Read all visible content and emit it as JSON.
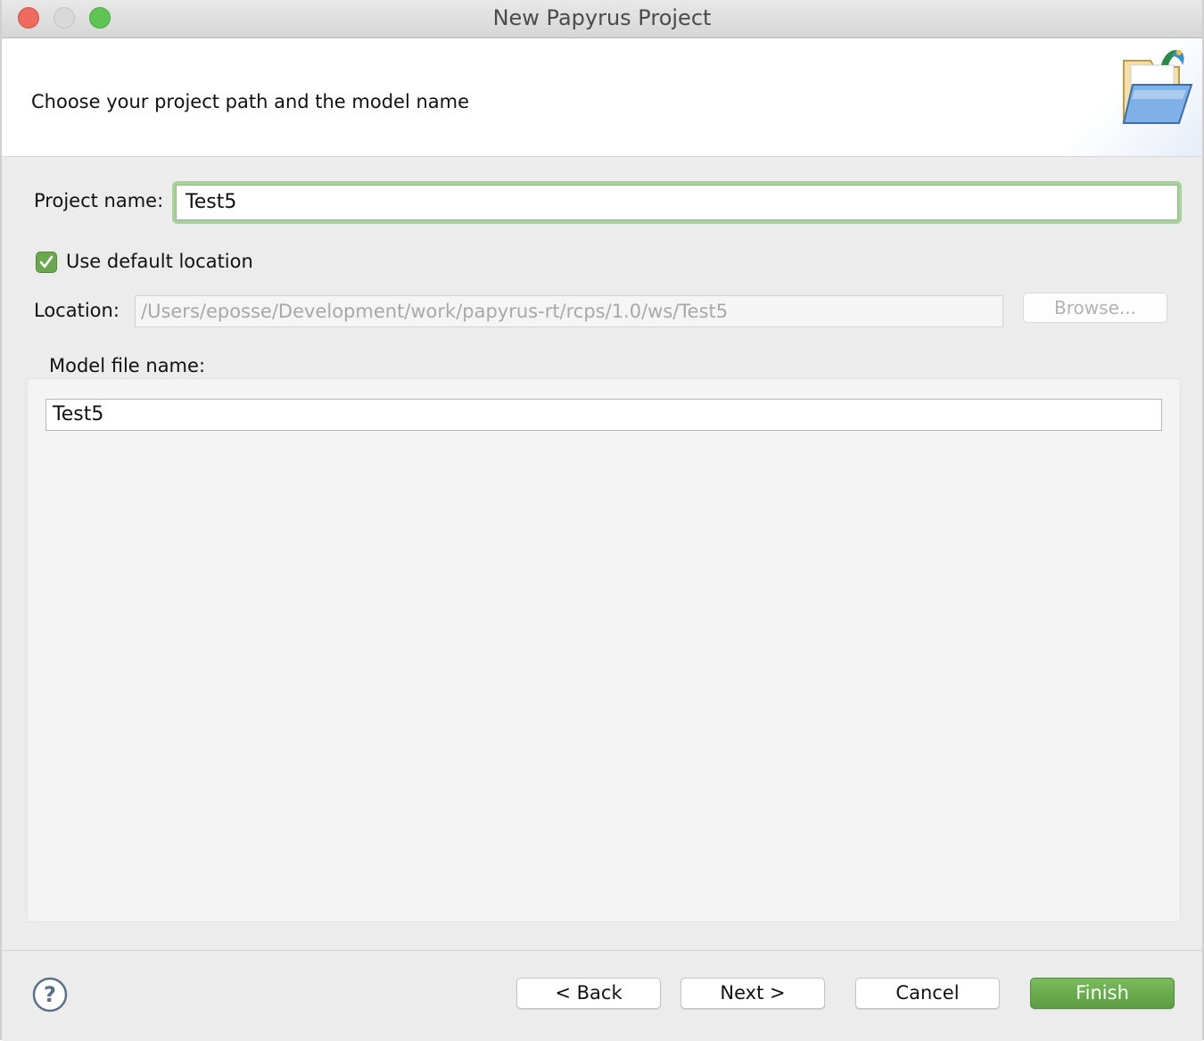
{
  "window": {
    "title": "New Papyrus Project"
  },
  "banner": {
    "message": "Choose your project path and the model name",
    "icon": "folder-open-icon"
  },
  "project": {
    "label": "Project name:",
    "value": "Test5"
  },
  "default_location": {
    "label": "Use default location",
    "checked": true
  },
  "location": {
    "label": "Location:",
    "value": "/Users/eposse/Development/work/papyrus-rt/rcps/1.0/ws/Test5",
    "browse_label": "Browse..."
  },
  "model": {
    "label": "Model file name:",
    "value": "Test5"
  },
  "footer": {
    "help_icon": "help-icon",
    "back_label": "< Back",
    "next_label": "Next >",
    "cancel_label": "Cancel",
    "finish_label": "Finish"
  },
  "colors": {
    "accent": "#6aa84f",
    "focus_ring": "#a9d19c"
  }
}
